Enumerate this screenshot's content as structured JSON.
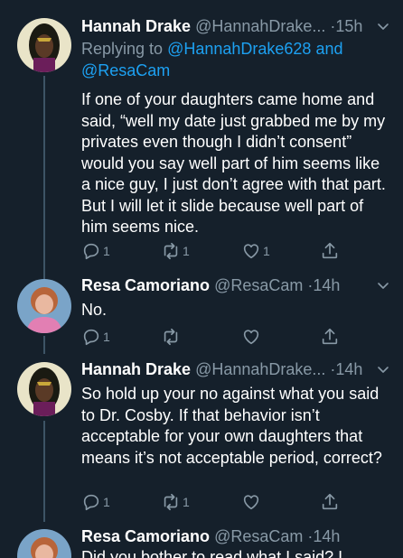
{
  "colors": {
    "background": "#15202b",
    "text": "#ffffff",
    "secondary": "#8899a6",
    "link": "#1da1f2",
    "thread": "#3d5466"
  },
  "tweets": [
    {
      "name": "Hannah Drake",
      "handle": "@HannahDrake...",
      "dot": " ·",
      "time": "15h",
      "reply_prefix": "Replying to ",
      "reply_to_1": "@HannahDrake628",
      "reply_and": " and",
      "reply_to_2": "@ResaCam",
      "text": "If one of your daughters came home and said, “well my date just grabbed me by my privates even though I didn’t consent” would you say well part of him seems like a nice guy, I just don’t agree with that part. But I will let it slide because well part of him seems nice.",
      "replies": "1",
      "retweets": "1",
      "likes": "1",
      "icons": [
        "comment-icon",
        "retweet-icon",
        "heart-icon",
        "share-icon",
        "chevron-down-icon"
      ]
    },
    {
      "name": "Resa Camoriano",
      "handle": "@ResaCam",
      "dot": " ·",
      "time": "14h",
      "text": "No.",
      "replies": "1",
      "retweets": "",
      "likes": ""
    },
    {
      "name": "Hannah Drake",
      "handle": "@HannahDrake...",
      "dot": " ·",
      "time": "14h",
      "text": "So hold up your no against what you said to Dr. Cosby. If that behavior isn’t acceptable for your own daughters that means it’s not acceptable period, correct?",
      "replies": "1",
      "retweets": "1",
      "likes": ""
    },
    {
      "name": "Resa Camoriano",
      "handle": "@ResaCam",
      "dot": " ·",
      "time": "14h",
      "text": "Did you bother to read what I said? I"
    }
  ]
}
